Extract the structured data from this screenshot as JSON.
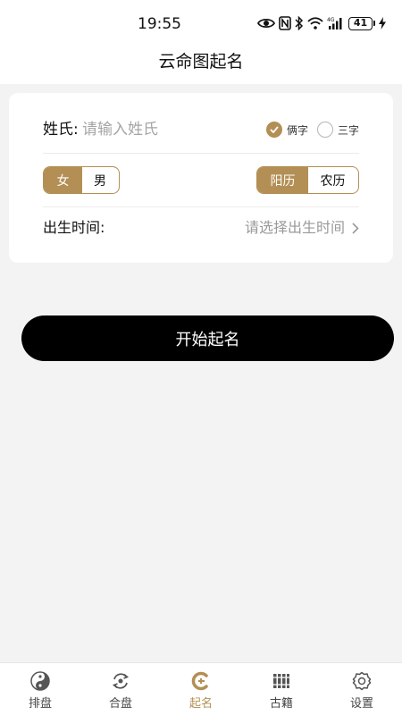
{
  "status_bar": {
    "time": "19:55",
    "battery": "41",
    "icons": [
      "eye-icon",
      "nfc-icon",
      "bluetooth-icon",
      "wifi-icon",
      "4g-signal-icon",
      "battery-icon",
      "charging-icon"
    ]
  },
  "header": {
    "title": "云命图起名"
  },
  "form": {
    "surname": {
      "label": "姓氏:",
      "placeholder": "请输入姓氏",
      "value": ""
    },
    "name_length": {
      "options": [
        {
          "label": "俩字",
          "selected": true
        },
        {
          "label": "三字",
          "selected": false
        }
      ]
    },
    "gender": {
      "options": [
        {
          "label": "女",
          "active": true
        },
        {
          "label": "男",
          "active": false
        }
      ]
    },
    "calendar": {
      "options": [
        {
          "label": "阳历",
          "active": true
        },
        {
          "label": "农历",
          "active": false
        }
      ]
    },
    "birth_time": {
      "label": "出生时间:",
      "placeholder": "请选择出生时间"
    }
  },
  "start_button": {
    "label": "开始起名"
  },
  "tab_bar": {
    "items": [
      {
        "label": "排盘",
        "icon": "yin-yang-icon",
        "active": false
      },
      {
        "label": "合盘",
        "icon": "refresh-circle-icon",
        "active": false
      },
      {
        "label": "起名",
        "icon": "name-c-icon",
        "active": true
      },
      {
        "label": "古籍",
        "icon": "books-icon",
        "active": false
      },
      {
        "label": "设置",
        "icon": "settings-icon",
        "active": false
      }
    ]
  },
  "colors": {
    "accent": "#b38f55",
    "button": "#000000",
    "background": "#f3f3f3"
  }
}
